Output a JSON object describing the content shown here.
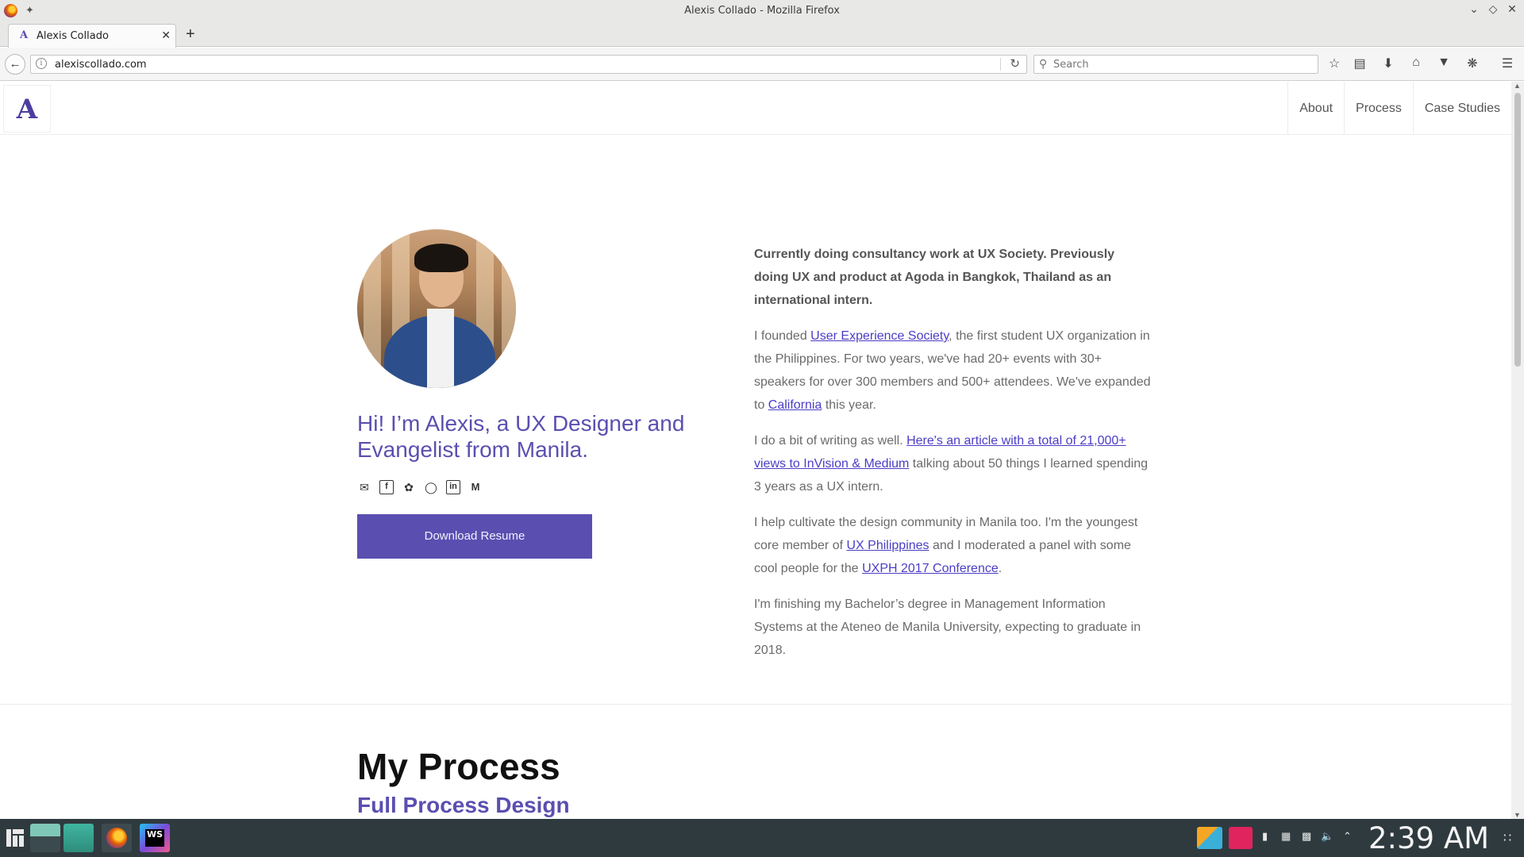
{
  "window": {
    "title": "Alexis Collado - Mozilla Firefox",
    "controls": [
      "minimize",
      "maximize",
      "close"
    ]
  },
  "tabs": [
    {
      "label": "Alexis Collado",
      "favicon": "A",
      "active": true
    }
  ],
  "toolbar": {
    "url": "alexiscollado.com",
    "search_placeholder": "Search",
    "icons": [
      "bookmark-star-icon",
      "reading-list-icon",
      "download-icon",
      "home-icon",
      "pocket-icon",
      "extension-icon",
      "menu-icon"
    ]
  },
  "site": {
    "logo": "A",
    "nav": [
      "About",
      "Process",
      "Case Studies"
    ],
    "hero": {
      "greeting": "Hi! I’m Alexis, a UX Designer and Evangelist from Manila.",
      "resume_button": "Download Resume",
      "socials": [
        "mail-icon",
        "facebook-icon",
        "twitter-icon",
        "dribbble-icon",
        "linkedin-icon",
        "medium-icon"
      ]
    },
    "bio": {
      "lead": "Currently doing consultancy work at UX Society. Previously doing UX and product at Agoda in Bangkok, Thailand as an international intern.",
      "p1_pre": "I founded ",
      "p1_link": "User Experience Society",
      "p1_mid": ", the first student UX organization in the Philippines. For two years, we've had 20+ events with 30+ speakers for over 300 members and 500+ attendees. We've expanded to ",
      "p1_link2": "California",
      "p1_post": " this year.",
      "p2_pre": "I do a bit of writing as well. ",
      "p2_link": "Here's an article with a total of 21,000+ views to InVision & Medium",
      "p2_post": " talking about 50 things I learned spending 3 years as a UX intern.",
      "p3_pre": "I help cultivate the design community in Manila too. I'm the youngest core member of ",
      "p3_link": "UX Philippines",
      "p3_mid": " and I moderated a panel with some cool people for the ",
      "p3_link2": "UXPH 2017 Conference",
      "p3_post": ".",
      "p4": "I'm finishing my Bachelor’s degree in Management Information Systems at the Ateneo de Manila University, expecting to graduate in 2018."
    },
    "process": {
      "title": "My Process",
      "subtitle": "Full Process Design"
    }
  },
  "taskbar": {
    "clock": "2:39 AM",
    "apps": [
      "desktop-app",
      "files-app",
      "firefox-app",
      "webstorm-app"
    ]
  },
  "colors": {
    "accent": "#5a4fb0",
    "link": "#4b3dc6",
    "taskbar": "#2f3a3f"
  }
}
